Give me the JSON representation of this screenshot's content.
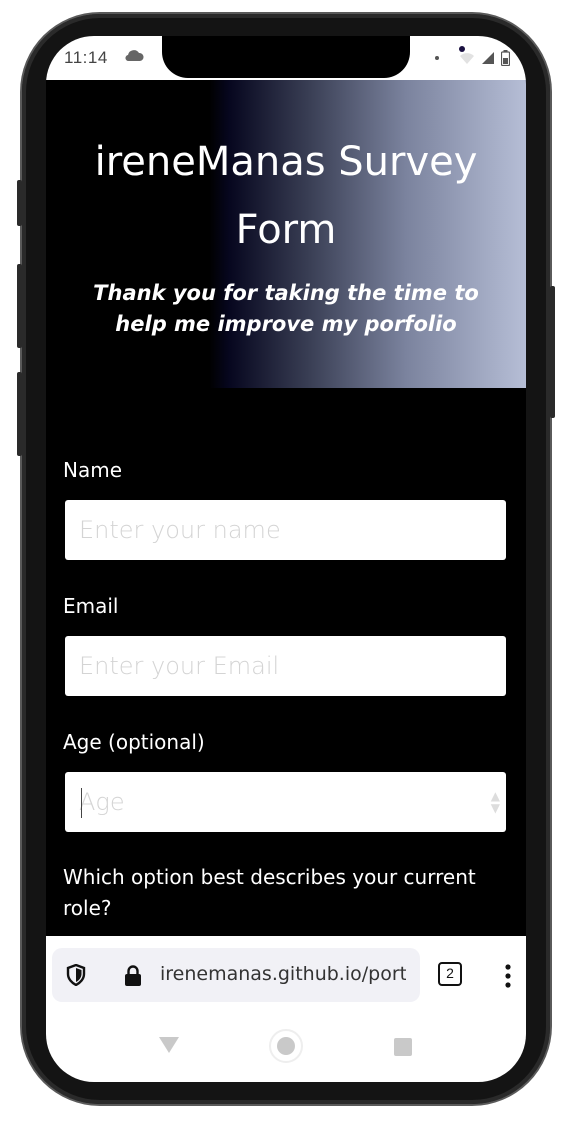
{
  "status_bar": {
    "time": "11:14"
  },
  "header": {
    "title": "ireneManas Survey Form",
    "subtitle": "Thank you for taking the time to help me improve my porfolio"
  },
  "form": {
    "name_label": "Name",
    "name_placeholder": "Enter your name",
    "email_label": "Email",
    "email_placeholder": "Enter your Email",
    "age_label": "Age (optional)",
    "age_placeholder": "Age",
    "role_question": "Which option best describes your current role?"
  },
  "browser": {
    "url": "irenemanas.github.io/portfolio",
    "tab_count": "2"
  },
  "colors": {
    "background": "#000000",
    "header_gradient_end": "#b6bed6",
    "text": "#ffffff",
    "input_bg": "#ffffff",
    "placeholder": "#d4d4d4"
  }
}
